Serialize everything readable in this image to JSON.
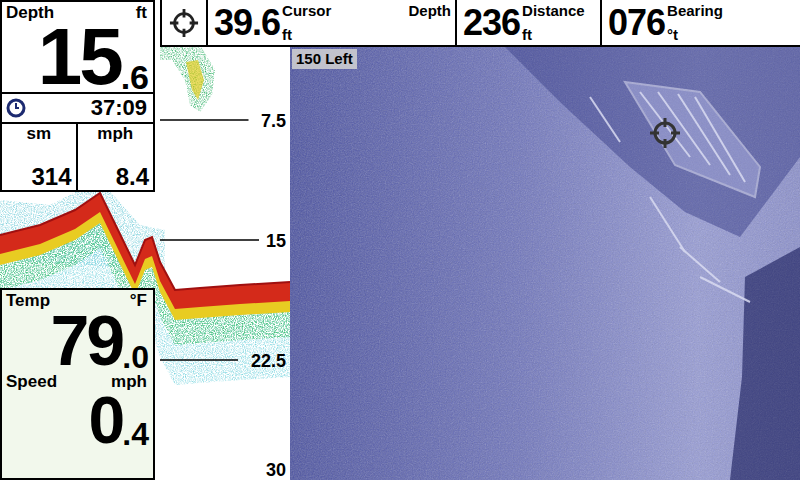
{
  "depth_box": {
    "label": "Depth",
    "unit": "ft",
    "value_whole": "15",
    "value_decimal": ".6",
    "timer": "37:09",
    "trip": [
      {
        "label": "sm",
        "value": "314"
      },
      {
        "label": "mph",
        "value": "8.4"
      }
    ]
  },
  "readouts": [
    {
      "value": "39.6",
      "unit": "ft",
      "label": "Cursor",
      "label2": "Depth"
    },
    {
      "value": "236",
      "unit": "ft",
      "label": "Distance",
      "label2": ""
    },
    {
      "value": "076",
      "unit": "°t",
      "label": "Bearing",
      "label2": ""
    }
  ],
  "sonar_chart": {
    "scale": [
      "7.5",
      "15",
      "22.5",
      "30"
    ]
  },
  "side_image": {
    "range_label": "150 Left"
  },
  "temp_box": {
    "label": "Temp",
    "unit": "°F",
    "value_whole": "79",
    "value_decimal": ".0"
  },
  "speed_box": {
    "label": "Speed",
    "unit": "mph",
    "value_whole": "0",
    "value_decimal": ".4"
  }
}
